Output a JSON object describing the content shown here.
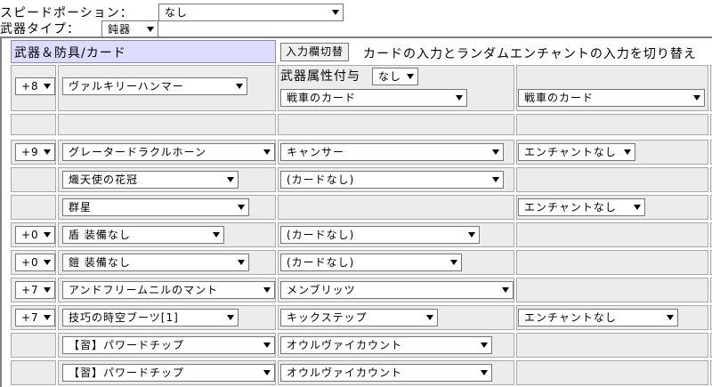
{
  "speed_potion": {
    "label": "スピードポーション：",
    "value": "なし"
  },
  "weapon_type": {
    "label": "武器タイプ：",
    "value": "鈍器"
  },
  "header": {
    "title": "武器＆防具/カード",
    "toggle_button": "入力欄切替",
    "description": "カードの入力とランダムエンチャントの入力を切り替え"
  },
  "weapon": {
    "refine": "+8",
    "item": "ヴァルキリーハンマー",
    "element_label": "武器属性付与",
    "element_value": "なし",
    "card1": "戦車のカード",
    "card2": "戦車のカード"
  },
  "headgear_upper": {
    "refine": "+9",
    "item": "グレータードラクルホーン",
    "card": "キャンサー",
    "enchant": "エンチャントなし"
  },
  "headgear_middle": {
    "item": "熾天使の花冠",
    "card": "(カードなし)"
  },
  "headgear_lower": {
    "item": "群星",
    "enchant": "エンチャントなし"
  },
  "shield": {
    "refine": "+0",
    "item": "盾 装備なし",
    "card": "(カードなし)"
  },
  "armor": {
    "refine": "+0",
    "item": "鎧 装備なし",
    "card": "(カードなし)"
  },
  "garment": {
    "refine": "+7",
    "item": "アンドフリームニルのマント",
    "card": "メンブリッツ"
  },
  "shoes": {
    "refine": "+7",
    "item": "技巧の時空ブーツ[1]",
    "card": "キックステップ",
    "enchant": "エンチャントなし"
  },
  "accessory1": {
    "item": "【習】パワードチップ",
    "card": "オウルヴァイカウント"
  },
  "accessory2": {
    "item": "【習】パワードチップ",
    "card": "オウルヴァイカウント"
  }
}
